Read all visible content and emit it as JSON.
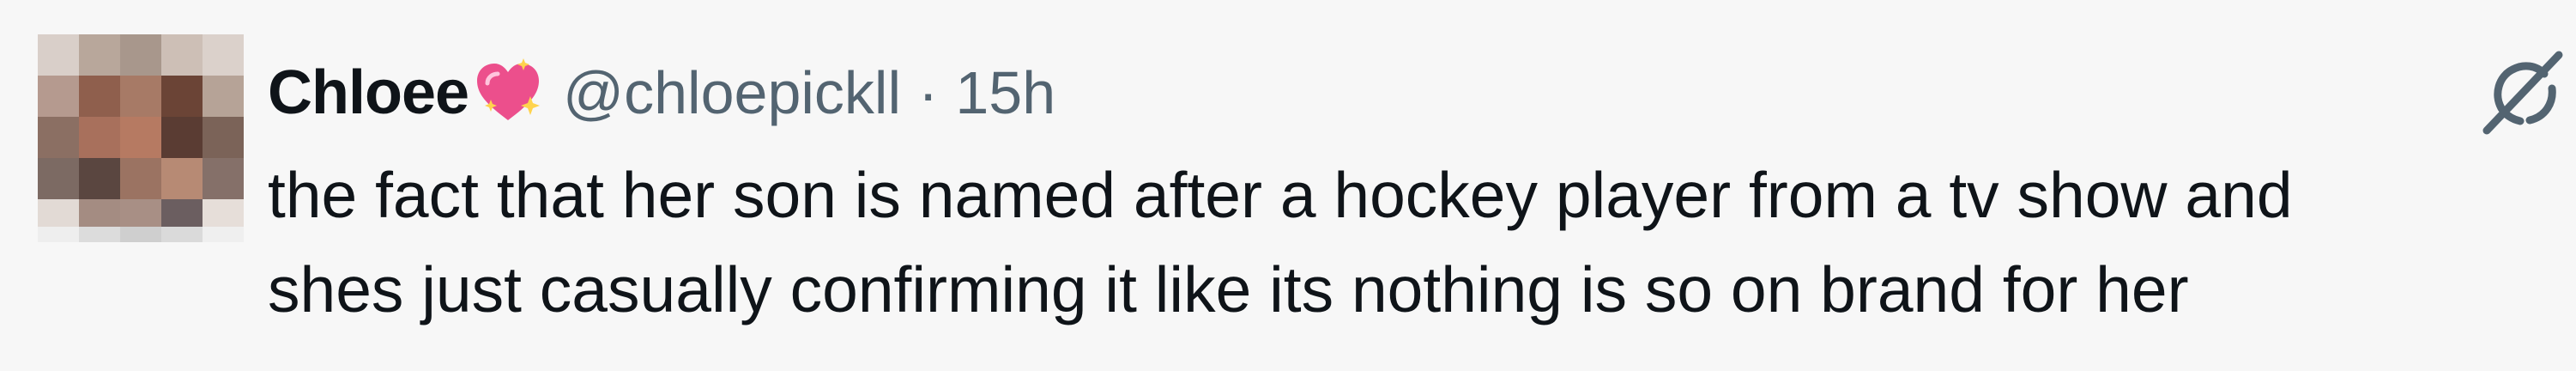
{
  "tweet": {
    "display_name": "Chloee",
    "display_name_emoji": "sparkling-heart",
    "handle": "@chloepickll",
    "separator": "·",
    "timestamp": "15h",
    "text_lines": [
      "the fact that her son is named after a hockey player from a tv show and",
      "shes just casually confirming it like its nothing is so on brand for her"
    ]
  },
  "avatar": {
    "pixelated": true,
    "cells": [
      "#d9cfc9",
      "#b8a79b",
      "#a8978c",
      "#cdbfb6",
      "#dbd1cb",
      "#b59a8f",
      "#8f5f4d",
      "#a77a66",
      "#6b4436",
      "#b6a397",
      "#8b6f63",
      "#a8705c",
      "#b67a62",
      "#5a3c33",
      "#7b6358",
      "#7c6a63",
      "#5a4640",
      "#9b7362",
      "#b78a74",
      "#857069",
      "#e2dad5",
      "#a48c82",
      "#a88f85",
      "#6b5e60",
      "#e6ded9"
    ],
    "fade_cells": [
      "#eeeeee",
      "#dcdcdc",
      "#cfcfcf",
      "#dadada",
      "#efefef"
    ]
  },
  "icons": {
    "emoji": "sparkling-heart-icon",
    "action": "grok-icon"
  },
  "colors": {
    "background": "#f7f7f7",
    "text_primary": "#0f1419",
    "text_secondary": "#536471",
    "emoji_pink": "#ec4f8c"
  }
}
